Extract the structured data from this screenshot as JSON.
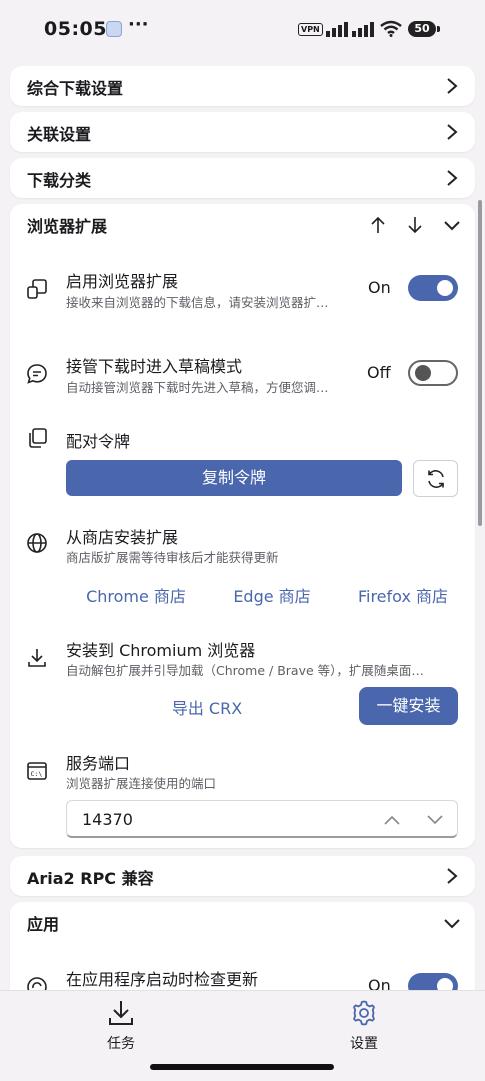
{
  "status_bar": {
    "time": "05:05",
    "dots": "···",
    "vpn": "VPN",
    "battery": "50"
  },
  "sections": {
    "general_download": {
      "title": "综合下载设置"
    },
    "association": {
      "title": "关联设置"
    },
    "download_category": {
      "title": "下载分类"
    },
    "browser_ext": {
      "title": "浏览器扩展",
      "enable": {
        "title": "启用浏览器扩展",
        "subtitle": "接收来自浏览器的下载信息，请安装浏览器扩…",
        "state": "On"
      },
      "draft": {
        "title": "接管下载时进入草稿模式",
        "subtitle": "自动接管浏览器下载时先进入草稿，方便您调…",
        "state": "Off"
      },
      "token": {
        "title": "配对令牌",
        "copy_label": "复制令牌"
      },
      "store": {
        "title": "从商店安装扩展",
        "subtitle": "商店版扩展需等待审核后才能获得更新",
        "links": [
          "Chrome 商店",
          "Edge 商店",
          "Firefox 商店"
        ]
      },
      "chromium": {
        "title": "安装到 Chromium 浏览器",
        "subtitle": "自动解包扩展并引导加载（Chrome / Brave 等），扩展随桌面…",
        "export_label": "导出 CRX",
        "install_label": "一键安装"
      },
      "port": {
        "title": "服务端口",
        "subtitle": "浏览器扩展连接使用的端口",
        "value": "14370"
      }
    },
    "aria2": {
      "title": "Aria2 RPC 兼容"
    },
    "app": {
      "title": "应用",
      "check_update": {
        "title": "在应用程序启动时检查更新",
        "state": "On"
      }
    }
  },
  "bottom_nav": {
    "tasks": "任务",
    "settings": "设置"
  },
  "colors": {
    "accent": "#4a67ae",
    "background": "#f4f2f4",
    "card": "#ffffff"
  }
}
